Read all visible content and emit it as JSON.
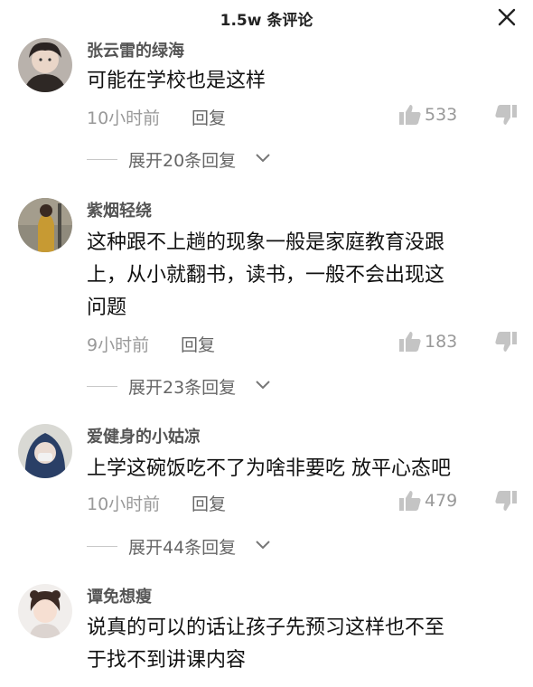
{
  "header": {
    "title": "1.5w 条评论"
  },
  "comments": [
    {
      "username": "张云雷的绿海",
      "lines": [
        "可能在学校也是这样"
      ],
      "time": "10小时前",
      "reply_label": "回复",
      "likes": "533",
      "expand_label": "展开20条回复"
    },
    {
      "username": "紫烟轻绕",
      "lines": [
        "这种跟不上趟的现象一般是家庭教育没跟",
        "上，从小就翻书，读书，一般不会出现这",
        "问题"
      ],
      "time": "9小时前",
      "reply_label": "回复",
      "likes": "183",
      "expand_label": "展开23条回复"
    },
    {
      "username": "爱健身的小姑凉",
      "lines": [
        "上学这碗饭吃不了为啥非要吃 放平心态吧"
      ],
      "time": "10小时前",
      "reply_label": "回复",
      "likes": "479",
      "expand_label": "展开44条回复"
    },
    {
      "username": "谭免想瘦",
      "lines": [
        "说真的可以的话让孩子先预习这样也不至",
        "于找不到讲课内容"
      ]
    }
  ],
  "colors": {
    "text": "#111111",
    "username": "#555555",
    "meta": "#999999",
    "like_icon": "#c4c4c4"
  },
  "icons": {
    "close": "close-icon",
    "like": "thumbs-up-icon",
    "dislike": "thumbs-down-icon",
    "expand": "chevron-down-icon"
  }
}
